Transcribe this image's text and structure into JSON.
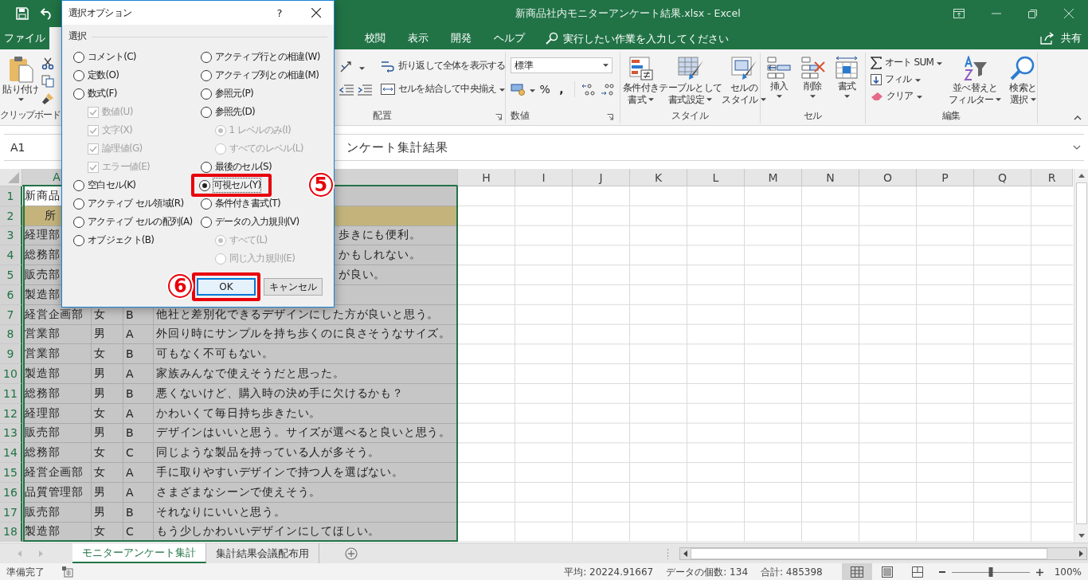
{
  "window": {
    "title": "新商品社内モニターアンケート結果.xlsx  -  Excel"
  },
  "tabs": [
    {
      "label": "ファイル",
      "selected": false
    },
    {
      "label": "校閲",
      "selected": false
    },
    {
      "label": "表示",
      "selected": false
    },
    {
      "label": "開発",
      "selected": false
    },
    {
      "label": "ヘルプ",
      "selected": false
    }
  ],
  "tell_me": {
    "placeholder": "実行したい作業を入力してください"
  },
  "share": "共有",
  "ribbon": {
    "clipboard": {
      "paste": "貼り付け",
      "label": "クリップボード"
    },
    "alignment": {
      "wrap": "折り返して全体を表示する",
      "merge": "セルを結合して中央揃え",
      "label": "配置"
    },
    "number": {
      "format": "標準",
      "percent": "%",
      "comma": ",",
      "label": "数値"
    },
    "styles": {
      "buttons": [
        {
          "lines": [
            "条件付き",
            "書式"
          ]
        },
        {
          "lines": [
            "テーブルとして",
            "書式設定"
          ]
        },
        {
          "lines": [
            "セルの",
            "スタイル"
          ]
        }
      ],
      "label": "スタイル"
    },
    "cells": {
      "buttons": [
        "挿入",
        "削除",
        "書式"
      ],
      "label": "セル"
    },
    "editing": {
      "autosum": "オート SUM",
      "fill": "フィル",
      "clear": "クリア",
      "sort": [
        "並べ替えと",
        "フィルター"
      ],
      "find": [
        "検索と",
        "選択"
      ],
      "label": "編集"
    }
  },
  "formula_bar": {
    "name_box": "A1",
    "content": "ンケート集計結果"
  },
  "columns": [
    "A",
    "H",
    "I",
    "J",
    "K",
    "L",
    "M",
    "N",
    "O",
    "P",
    "Q",
    "R"
  ],
  "rows": [
    {
      "num": "1",
      "kind": "title",
      "a": "新商品"
    },
    {
      "num": "2",
      "kind": "header",
      "a": "所"
    },
    {
      "num": "3",
      "kind": "data",
      "a": "経理部",
      "d_tail": "歩きにも便利。"
    },
    {
      "num": "4",
      "kind": "data",
      "a": "総務部",
      "d_tail": "かもしれない。"
    },
    {
      "num": "5",
      "kind": "data",
      "a": "販売部",
      "d_tail": "が良い。"
    },
    {
      "num": "6",
      "kind": "data",
      "a": "製造部"
    },
    {
      "num": "7",
      "kind": "data",
      "a": "経営企画部",
      "b": "女",
      "c": "B",
      "d": "他社と差別化できるデザインにした方が良いと思う。"
    },
    {
      "num": "8",
      "kind": "data",
      "a": "営業部",
      "b": "男",
      "c": "A",
      "d": "外回り時にサンプルを持ち歩くのに良さそうなサイズ。"
    },
    {
      "num": "9",
      "kind": "data",
      "a": "営業部",
      "b": "女",
      "c": "B",
      "d": "可もなく不可もない。"
    },
    {
      "num": "10",
      "kind": "data",
      "a": "製造部",
      "b": "男",
      "c": "A",
      "d": "家族みんなで使えそうだと思った。"
    },
    {
      "num": "11",
      "kind": "data",
      "a": "総務部",
      "b": "男",
      "c": "B",
      "d": "悪くないけど、購入時の決め手に欠けるかも？"
    },
    {
      "num": "12",
      "kind": "data",
      "a": "経理部",
      "b": "女",
      "c": "A",
      "d": "かわいくて毎日持ち歩きたい。"
    },
    {
      "num": "13",
      "kind": "data",
      "a": "販売部",
      "b": "男",
      "c": "B",
      "d": "デザインはいいと思う。サイズが選べると良いと思う。"
    },
    {
      "num": "14",
      "kind": "data",
      "a": "総務部",
      "b": "女",
      "c": "C",
      "d": "同じような製品を持っている人が多そう。"
    },
    {
      "num": "15",
      "kind": "data",
      "a": "経営企画部",
      "b": "女",
      "c": "A",
      "d": "手に取りやすいデザインで持つ人を選ばない。"
    },
    {
      "num": "16",
      "kind": "data",
      "a": "品質管理部",
      "b": "男",
      "c": "A",
      "d": "さまざまなシーンで使えそう。"
    },
    {
      "num": "17",
      "kind": "data",
      "a": "販売部",
      "b": "男",
      "c": "B",
      "d": "それなりにいいと思う。"
    },
    {
      "num": "18",
      "kind": "data",
      "a": "製造部",
      "b": "女",
      "c": "C",
      "d": "もう少しかわいいデザインにしてほしい。"
    }
  ],
  "sheet_tabs": [
    {
      "label": "モニターアンケート集計",
      "selected": true
    },
    {
      "label": "集計結果会議配布用",
      "selected": false
    }
  ],
  "status_bar": {
    "ready": "準備完了",
    "stats": [
      "平均: 20224.91667",
      "データの個数: 134",
      "合計: 485398"
    ],
    "views": [
      {
        "kind": "normal",
        "selected": true
      },
      {
        "kind": "layout",
        "selected": false
      },
      {
        "kind": "pagebreak",
        "selected": false
      }
    ],
    "zoom": {
      "level": 0.5,
      "reading": "100%"
    }
  },
  "dialog": {
    "title": "選択オプション",
    "help": "?",
    "group": "選択",
    "left": [
      {
        "label": "コメント(C)",
        "kind": "radio",
        "selected": false,
        "disabled": false
      },
      {
        "label": "定数(O)",
        "kind": "radio",
        "selected": false,
        "disabled": false
      },
      {
        "label": "数式(F)",
        "kind": "radio",
        "selected": false,
        "disabled": false,
        "children": [
          {
            "label": "数値(U)",
            "kind": "checkbox",
            "checked": true,
            "disabled": true
          },
          {
            "label": "文字(X)",
            "kind": "checkbox",
            "checked": true,
            "disabled": true
          },
          {
            "label": "論理値(G)",
            "kind": "checkbox",
            "checked": true,
            "disabled": true
          },
          {
            "label": "エラー値(E)",
            "kind": "checkbox",
            "checked": true,
            "disabled": true
          }
        ]
      },
      {
        "label": "空白セル(K)",
        "kind": "radio",
        "selected": false,
        "disabled": false
      },
      {
        "label": "アクティブ セル領域(R)",
        "kind": "radio",
        "selected": false,
        "disabled": false
      },
      {
        "label": "アクティブ セルの配列(A)",
        "kind": "radio",
        "selected": false,
        "disabled": false
      },
      {
        "label": "オブジェクト(B)",
        "kind": "radio",
        "selected": false,
        "disabled": false
      }
    ],
    "right": [
      {
        "label": "アクティブ行との相違(W)",
        "kind": "radio",
        "selected": false,
        "disabled": false
      },
      {
        "label": "アクティブ列との相違(M)",
        "kind": "radio",
        "selected": false,
        "disabled": false
      },
      {
        "label": "参照元(P)",
        "kind": "radio",
        "selected": false,
        "disabled": false
      },
      {
        "label": "参照先(D)",
        "kind": "radio",
        "selected": false,
        "disabled": false,
        "children": [
          {
            "label": "1 レベルのみ(I)",
            "kind": "radio",
            "selected": true,
            "disabled": true
          },
          {
            "label": "すべてのレベル(L)",
            "kind": "radio",
            "selected": false,
            "disabled": true
          }
        ]
      },
      {
        "label": "最後のセル(S)",
        "kind": "radio",
        "selected": false,
        "disabled": false
      },
      {
        "label": "可視セル(Y)",
        "kind": "radio",
        "selected": true,
        "disabled": false,
        "callout": "5"
      },
      {
        "label": "条件付き書式(T)",
        "kind": "radio",
        "selected": false,
        "disabled": false
      },
      {
        "label": "データの入力規則(V)",
        "kind": "radio",
        "selected": false,
        "disabled": false,
        "children": [
          {
            "label": "すべて(L)",
            "kind": "radio",
            "selected": true,
            "disabled": true
          },
          {
            "label": "同じ入力規則(E)",
            "kind": "radio",
            "selected": false,
            "disabled": true
          }
        ]
      }
    ],
    "ok": {
      "label": "OK",
      "callout": "6"
    },
    "cancel": "キャンセル"
  }
}
